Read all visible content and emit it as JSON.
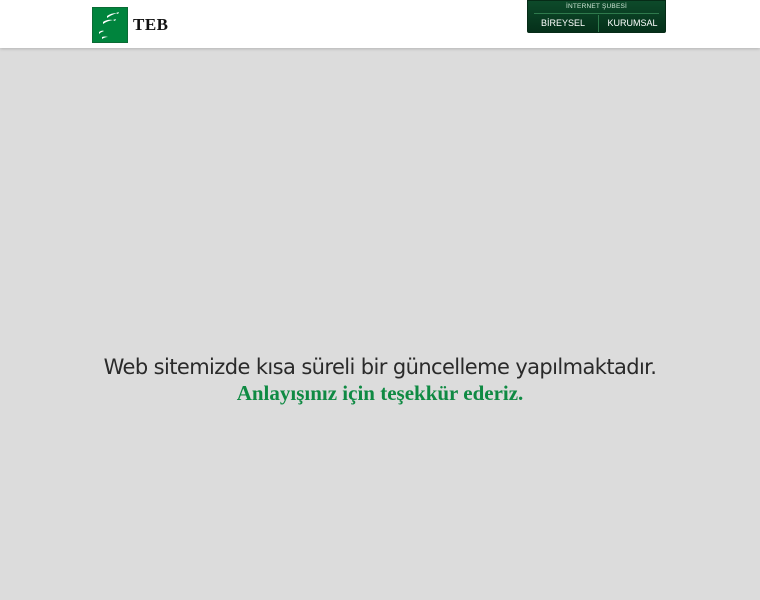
{
  "header": {
    "logo_text": "TEB",
    "internet_branch": {
      "title": "İNTERNET ŞUBESİ",
      "bireysel_label": "BİREYSEL",
      "kurumsal_label": "KURUMSAL"
    }
  },
  "message": {
    "line1": "Web sitemizde kısa süreli bir güncelleme yapılmaktadır.",
    "line2": "Anlayışınız için teşekkür ederiz."
  },
  "colors": {
    "brand_green": "#00843d",
    "message_green": "#0f8a43",
    "background": "#dcdcdc"
  },
  "icons": {
    "logo": "bnp-stars-logo-icon"
  }
}
